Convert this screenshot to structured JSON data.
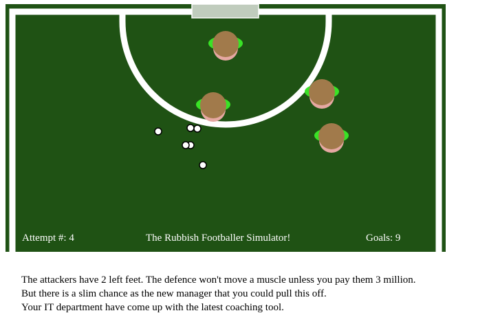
{
  "colors": {
    "grass": "#1f5214",
    "lines": "#ffffff",
    "goal": "#c0ccbd",
    "player_head": "#a17a4b",
    "player_body": "#e6a8a2",
    "player_feet": "#39e326",
    "ball_fill": "#ffffff",
    "ball_stroke": "#000000",
    "text": "#000000"
  },
  "hud": {
    "attempt_label": "Attempt #:",
    "attempt_value": 4,
    "title": "The Rubbish Footballer Simulator!",
    "goals_label": "Goals:",
    "goals_value": 9
  },
  "story": {
    "lines": [
      "The attackers have 2 left feet. The defence won't move a muscle unless you pay them 3 million.",
      "But there is a slim chance as the new manager that you could pull this off.",
      "Your IT department have come up with the latest coaching tool."
    ]
  },
  "entities": {
    "defenders": [
      {
        "name": "defender"
      },
      {
        "name": "defender"
      },
      {
        "name": "defender"
      },
      {
        "name": "defender"
      }
    ],
    "balls": [
      {
        "name": "ball"
      },
      {
        "name": "ball"
      },
      {
        "name": "ball"
      },
      {
        "name": "ball"
      },
      {
        "name": "ball"
      },
      {
        "name": "ball"
      }
    ]
  }
}
